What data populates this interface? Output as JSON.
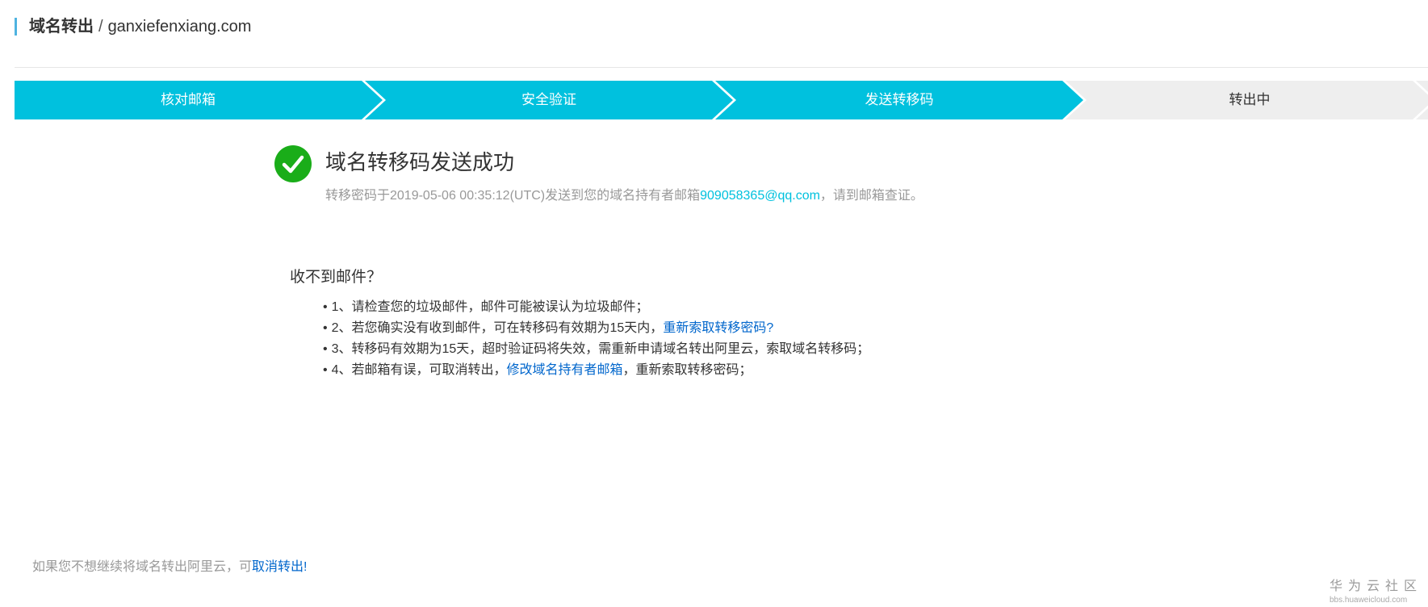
{
  "colors": {
    "accent": "#00c1de",
    "success": "#1aad19",
    "link": "#0066cc",
    "muted": "#999999",
    "text": "#333333",
    "step_todo": "#eeeeee"
  },
  "header": {
    "title": "域名转出",
    "separator": "/",
    "domain": "ganxiefenxiang.com"
  },
  "steps": [
    {
      "label": "核对邮箱",
      "completed": true
    },
    {
      "label": "安全验证",
      "completed": true
    },
    {
      "label": "发送转移码",
      "completed": true
    },
    {
      "label": "转出中",
      "completed": false
    }
  ],
  "result": {
    "icon": "check-circle-icon",
    "title": "域名转移码发送成功",
    "message_prefix": "转移密码于2019-05-06 00:35:12(UTC)发送到您的域名持有者邮箱",
    "email": "909058365@qq.com",
    "message_suffix": "，请到邮箱查证。"
  },
  "help": {
    "title": "收不到邮件？",
    "bullet": "•",
    "items": [
      {
        "text": "1、请检查您的垃圾邮件，邮件可能被误认为垃圾邮件；"
      },
      {
        "text": "2、若您确实没有收到邮件，可在转移码有效期为15天内，",
        "link": "重新索取转移密码?"
      },
      {
        "text": "3、转移码有效期为15天，超时验证码将失效，需重新申请域名转出阿里云，索取域名转移码；"
      },
      {
        "text": "4、若邮箱有误，可取消转出，",
        "link": "修改域名持有者邮箱",
        "text_after": "，重新索取转移密码；"
      }
    ]
  },
  "footer": {
    "text": "如果您不想继续将域名转出阿里云，可",
    "link": "取消转出!"
  },
  "watermark": {
    "brand": "华为云社区",
    "url": "bbs.huaweicloud.com"
  }
}
